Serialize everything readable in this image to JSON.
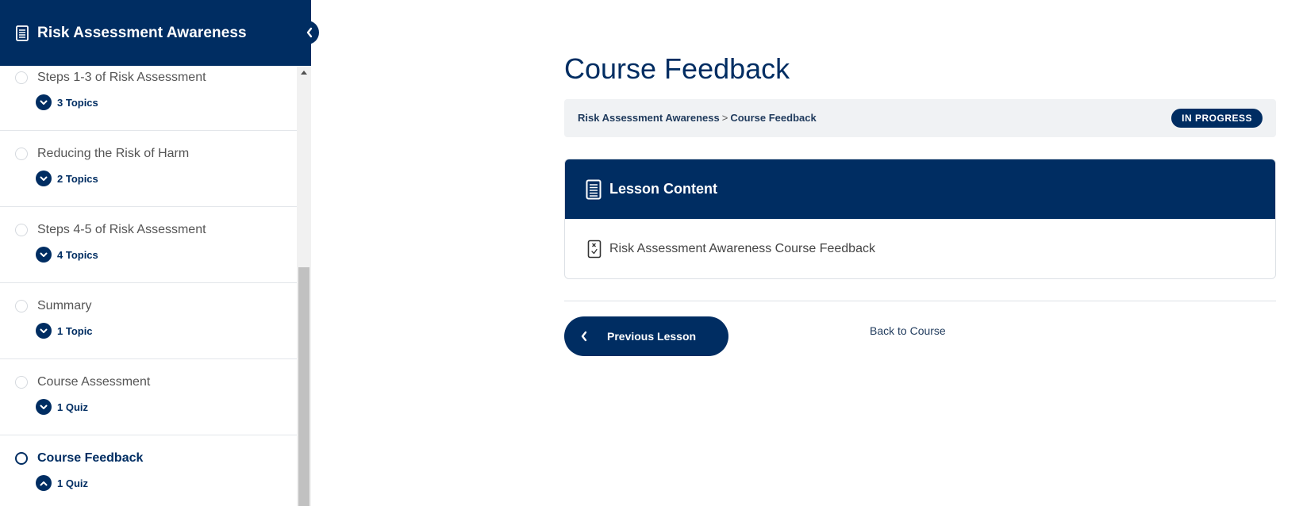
{
  "sidebar": {
    "title": "Risk Assessment Awareness",
    "items": [
      {
        "label": "Steps 1-3 of Risk Assessment",
        "topics": "3 Topics",
        "expanded": false
      },
      {
        "label": "Reducing the Risk of Harm",
        "topics": "2 Topics",
        "expanded": false
      },
      {
        "label": "Steps 4-5 of Risk Assessment",
        "topics": "4 Topics",
        "expanded": false
      },
      {
        "label": "Summary",
        "topics": "1 Topic",
        "expanded": false
      },
      {
        "label": "Course Assessment",
        "topics": "1 Quiz",
        "expanded": false
      },
      {
        "label": "Course Feedback",
        "topics": "1 Quiz",
        "expanded": true,
        "active": true
      }
    ]
  },
  "main": {
    "page_title": "Course Feedback",
    "breadcrumb": {
      "course": "Risk Assessment Awareness",
      "separator": ">",
      "current": "Course Feedback"
    },
    "status": "IN PROGRESS",
    "lesson_content": {
      "title": "Lesson Content",
      "items": [
        {
          "label": "Risk Assessment Awareness Course Feedback",
          "icon": "quiz-icon"
        }
      ]
    },
    "nav": {
      "previous_label": "Previous Lesson",
      "back_label": "Back to Course"
    }
  },
  "colors": {
    "brand": "#002d62",
    "breadcrumb_bg": "#f0f2f4",
    "border": "#dde1e6"
  }
}
